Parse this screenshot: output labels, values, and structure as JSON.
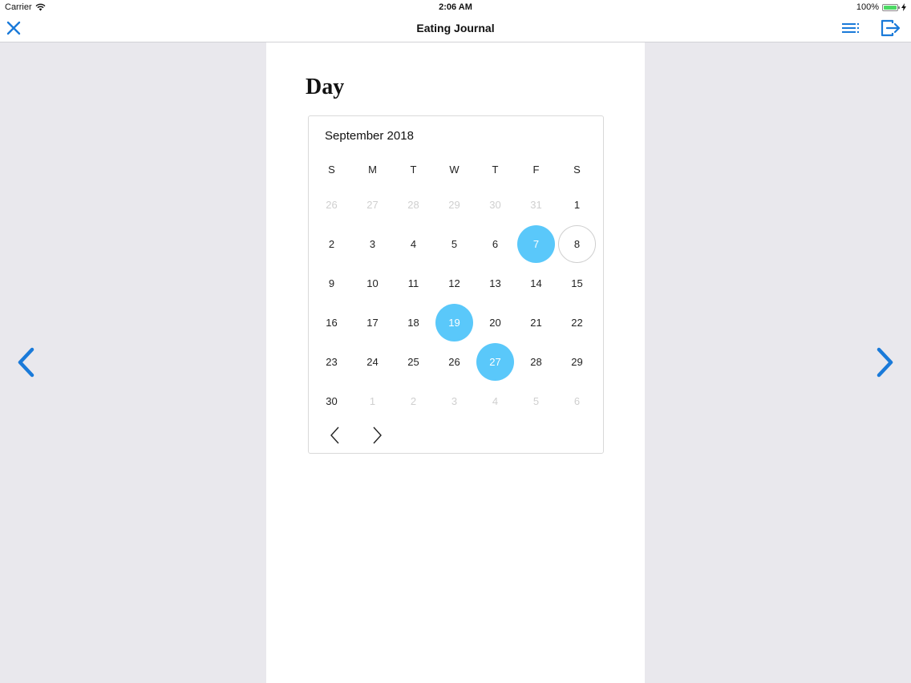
{
  "status_bar": {
    "carrier": "Carrier",
    "time": "2:06 AM",
    "battery": "100%"
  },
  "nav_bar": {
    "title": "Eating Journal",
    "icons": [
      "close-icon",
      "list-icon",
      "export-icon"
    ]
  },
  "page": {
    "heading": "Day"
  },
  "calendar": {
    "month": "September 2018",
    "weekdays": [
      "S",
      "M",
      "T",
      "W",
      "T",
      "F",
      "S"
    ],
    "weeks": [
      [
        {
          "d": "26",
          "other": true
        },
        {
          "d": "27",
          "other": true
        },
        {
          "d": "28",
          "other": true
        },
        {
          "d": "29",
          "other": true
        },
        {
          "d": "30",
          "other": true
        },
        {
          "d": "31",
          "other": true
        },
        {
          "d": "1"
        }
      ],
      [
        {
          "d": "2"
        },
        {
          "d": "3"
        },
        {
          "d": "4"
        },
        {
          "d": "5"
        },
        {
          "d": "6"
        },
        {
          "d": "7",
          "selected": true
        },
        {
          "d": "8",
          "today": true
        }
      ],
      [
        {
          "d": "9"
        },
        {
          "d": "10"
        },
        {
          "d": "11"
        },
        {
          "d": "12"
        },
        {
          "d": "13"
        },
        {
          "d": "14"
        },
        {
          "d": "15"
        }
      ],
      [
        {
          "d": "16"
        },
        {
          "d": "17"
        },
        {
          "d": "18"
        },
        {
          "d": "19",
          "selected": true
        },
        {
          "d": "20"
        },
        {
          "d": "21"
        },
        {
          "d": "22"
        }
      ],
      [
        {
          "d": "23"
        },
        {
          "d": "24"
        },
        {
          "d": "25"
        },
        {
          "d": "26"
        },
        {
          "d": "27",
          "selected": true
        },
        {
          "d": "28"
        },
        {
          "d": "29"
        }
      ],
      [
        {
          "d": "30"
        },
        {
          "d": "1",
          "other": true
        },
        {
          "d": "2",
          "other": true
        },
        {
          "d": "3",
          "other": true
        },
        {
          "d": "4",
          "other": true
        },
        {
          "d": "5",
          "other": true
        },
        {
          "d": "6",
          "other": true
        }
      ]
    ]
  },
  "colors": {
    "accent": "#1a7ad9",
    "selected_day": "#5ac8fa",
    "side_background": "#e9e8ed"
  }
}
